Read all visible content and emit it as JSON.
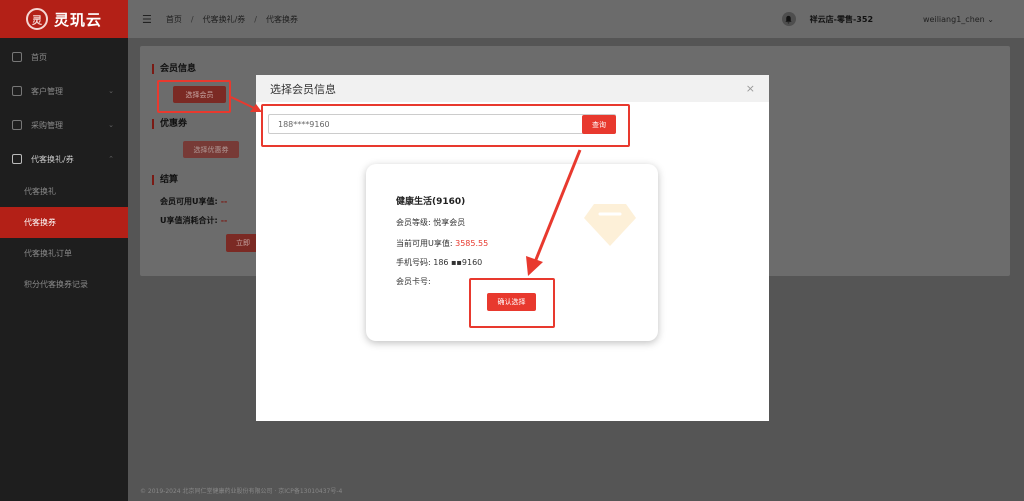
{
  "app": {
    "logo_mark": "灵",
    "logo_text": "灵玑云"
  },
  "sidebar": {
    "items": [
      {
        "label": "首页",
        "icon": "grid-icon"
      },
      {
        "label": "客户管理",
        "icon": "customer-icon",
        "chevron": "⌄"
      },
      {
        "label": "采购管理",
        "icon": "purchase-icon",
        "chevron": "⌄"
      },
      {
        "label": "代客换礼/券",
        "icon": "cart-icon",
        "chevron": "⌃"
      }
    ],
    "sub_items": [
      {
        "label": "代客换礼"
      },
      {
        "label": "代客换券"
      },
      {
        "label": "代客换礼订单"
      },
      {
        "label": "积分代客换券记录"
      }
    ]
  },
  "header": {
    "menu_icon": "☰",
    "breadcrumb": [
      "首页",
      "代客换礼/券",
      "代客换券"
    ],
    "separator": "/",
    "store": "祥云店-零售-352",
    "user": "weiliang1_chen ⌄"
  },
  "page": {
    "member_section": "会员信息",
    "select_member_btn": "选择会员",
    "coupon_section": "优惠券",
    "select_coupon_btn": "选择优惠券",
    "settle_section": "结算",
    "available_label": "会员可用U享值:",
    "available_value": "--",
    "total_label": "U享值消耗合计:",
    "total_value": "--",
    "submit_btn": "立即",
    "footer": "© 2019-2024 北京同仁堂健康药业股份有限公司 · 京ICP备13010437号-4"
  },
  "modal": {
    "title": "选择会员信息",
    "close": "×",
    "search_value": "188****9160",
    "query_btn": "查询",
    "member": {
      "name": "健康生活(9160)",
      "level_label": "会员等级:",
      "level_value": "悦享会员",
      "points_label": "当前可用U享值:",
      "points_value": "3585.55",
      "phone_label": "手机号码:",
      "phone_value": "186 ▪▪9160",
      "card_label": "会员卡号:",
      "confirm_btn": "确认选择"
    }
  },
  "colors": {
    "accent": "#e8392e",
    "brand_dark": "#b32017"
  }
}
